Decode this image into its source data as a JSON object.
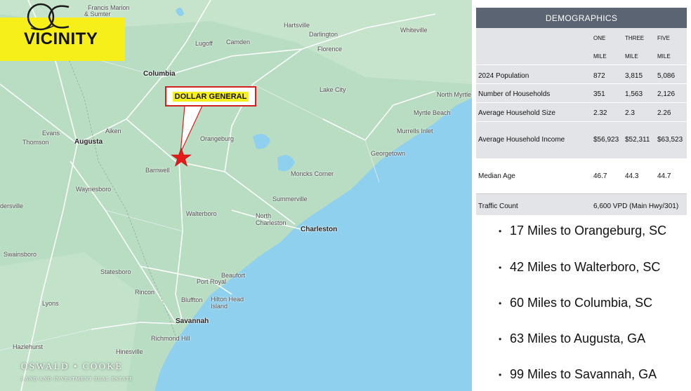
{
  "slide": {
    "title": "VICINITY",
    "callout_label": "DOLLAR GENERAL"
  },
  "map": {
    "places": [
      {
        "id": "francis-marion",
        "name": "Francis Marion"
      },
      {
        "id": "sumter",
        "name": "& Sumter"
      },
      {
        "id": "hartsville",
        "name": "Hartsville"
      },
      {
        "id": "darlington",
        "name": "Darlington"
      },
      {
        "id": "whiteville",
        "name": "Whiteville"
      },
      {
        "id": "lugoff",
        "name": "Lugoff"
      },
      {
        "id": "camden",
        "name": "Camden"
      },
      {
        "id": "florence",
        "name": "Florence"
      },
      {
        "id": "columbia",
        "name": "Columbia"
      },
      {
        "id": "lake-city",
        "name": "Lake City"
      },
      {
        "id": "north-myrtle-beach",
        "name": "North Myrtle Beach"
      },
      {
        "id": "myrtle-beach",
        "name": "Myrtle Beach"
      },
      {
        "id": "aiken",
        "name": "Aiken"
      },
      {
        "id": "evans",
        "name": "Evans"
      },
      {
        "id": "thomson",
        "name": "Thomson"
      },
      {
        "id": "augusta",
        "name": "Augusta"
      },
      {
        "id": "orangeburg",
        "name": "Orangeburg"
      },
      {
        "id": "murrells-inlet",
        "name": "Murrells Inlet"
      },
      {
        "id": "georgetown",
        "name": "Georgetown"
      },
      {
        "id": "barnwell",
        "name": "Barnwell"
      },
      {
        "id": "moncks-corner",
        "name": "Moncks Corner"
      },
      {
        "id": "waynesboro",
        "name": "Waynesboro"
      },
      {
        "id": "summerville",
        "name": "Summerville"
      },
      {
        "id": "dersville",
        "name": "dersville"
      },
      {
        "id": "walterboro",
        "name": "Walterboro"
      },
      {
        "id": "north-charleston",
        "name": "North Charleston"
      },
      {
        "id": "charleston",
        "name": "Charleston"
      },
      {
        "id": "swainsboro",
        "name": "Swainsboro"
      },
      {
        "id": "statesboro",
        "name": "Statesboro"
      },
      {
        "id": "port-royal",
        "name": "Port Royal"
      },
      {
        "id": "beaufort",
        "name": "Beaufort"
      },
      {
        "id": "rincon",
        "name": "Rincon"
      },
      {
        "id": "lyons",
        "name": "Lyons"
      },
      {
        "id": "bluffton",
        "name": "Bluffton"
      },
      {
        "id": "hilton-head",
        "name": "Hilton Head Island"
      },
      {
        "id": "savannah",
        "name": "Savannah"
      },
      {
        "id": "richmond-hill",
        "name": "Richmond Hill"
      },
      {
        "id": "hazlehurst",
        "name": "Hazlehurst"
      },
      {
        "id": "hinesville",
        "name": "Hinesville"
      }
    ]
  },
  "logo": {
    "name": "OSWALD • COOKE",
    "tagline": "LAND AND INVESTMENT REAL ESTATE"
  },
  "demographics": {
    "title": "DEMOGRAPHICS",
    "columns": [
      {
        "top": "ONE",
        "bottom": "MILE"
      },
      {
        "top": "THREE",
        "bottom": "MILE"
      },
      {
        "top": "FIVE",
        "bottom": "MILE"
      }
    ],
    "rows": [
      {
        "label": "2024 Population",
        "values": [
          "872",
          "3,815",
          "5,086"
        ]
      },
      {
        "label": "Number of Households",
        "values": [
          "351",
          "1,563",
          "2,126"
        ]
      },
      {
        "label": "Average Household Size",
        "values": [
          "2.32",
          "2.3",
          "2.26"
        ]
      },
      {
        "label": "Average Household Income",
        "values": [
          "$56,923",
          "$52,311",
          "$63,523"
        ]
      },
      {
        "label": "Median Age",
        "values": [
          "46.7",
          "44.3",
          "44.7"
        ]
      }
    ],
    "traffic": {
      "label": "Traffic Count",
      "value": "6,600 VPD (Main Hwy/301)"
    }
  },
  "distances": [
    "17 Miles to Orangeburg, SC",
    "42 Miles to Walterboro, SC",
    "60 Miles to Columbia, SC",
    "63 Miles to Augusta, GA",
    "99 Miles to Savannah, GA"
  ],
  "colors": {
    "header": "#5b6472",
    "accent_yellow": "#f7ef1a",
    "marker_red": "#e31b1b",
    "ocean": "#8fd0ee"
  }
}
